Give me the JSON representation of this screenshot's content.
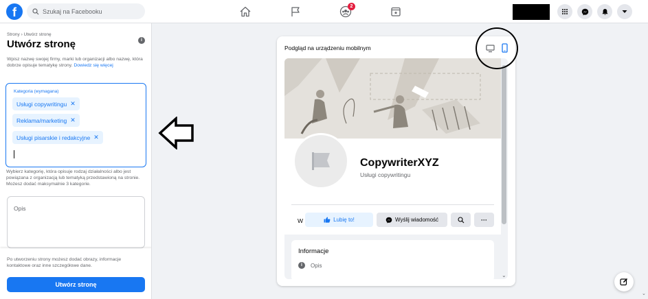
{
  "header": {
    "logo_letter": "f",
    "search_placeholder": "Szukaj na Facebooku",
    "notifications_badge": "2"
  },
  "sidebar": {
    "breadcrumb": "Strony › Utwórz stronę",
    "title": "Utwórz stronę",
    "description": "Wpisz nazwę swojej firmy, marki lub organizacji albo nazwę, która dobrze opisuje tematykę strony.",
    "learn_more": "Dowiedz się więcej",
    "category_label": "Kategoria (wymagana)",
    "categories": [
      {
        "label": "Usługi copywritingu"
      },
      {
        "label": "Reklama/marketing"
      },
      {
        "label": "Usługi pisarskie i redakcyjne"
      }
    ],
    "category_help": "Wybierz kategorię, która opisuje rodzaj działalności albo jest powiązana z organizacją lub tematyką przedstawioną na stronie. Możesz dodać maksymalnie 3 kategorie.",
    "description_label": "Opis",
    "footer_text": "Po utworzeniu strony możesz dodać obrazy, informacje kontaktowe oraz inne szczegółowe dane.",
    "create_button": "Utwórz stronę"
  },
  "preview": {
    "title": "Podgląd na urządzeniu mobilnym",
    "page_name": "CopywriterXYZ",
    "page_category": "Usługi copywritingu",
    "w_text": "W",
    "like_button": "Lubię to!",
    "message_button": "Wyślij wiadomość",
    "more_label": "···",
    "info_title": "Informacje",
    "info_row": "Opis"
  },
  "colors": {
    "brand": "#1877f2",
    "badge": "#e41e3f",
    "background": "#f0f2f5"
  },
  "icons": [
    "facebook-logo",
    "search-icon",
    "home-icon",
    "flag-icon",
    "groups-icon",
    "gaming-icon",
    "menu-grid-icon",
    "messenger-icon",
    "notifications-icon",
    "account-dropdown-icon",
    "desktop-icon",
    "mobile-icon",
    "info-icon",
    "like-icon",
    "messenger-icon",
    "search-icon",
    "edit-icon"
  ]
}
